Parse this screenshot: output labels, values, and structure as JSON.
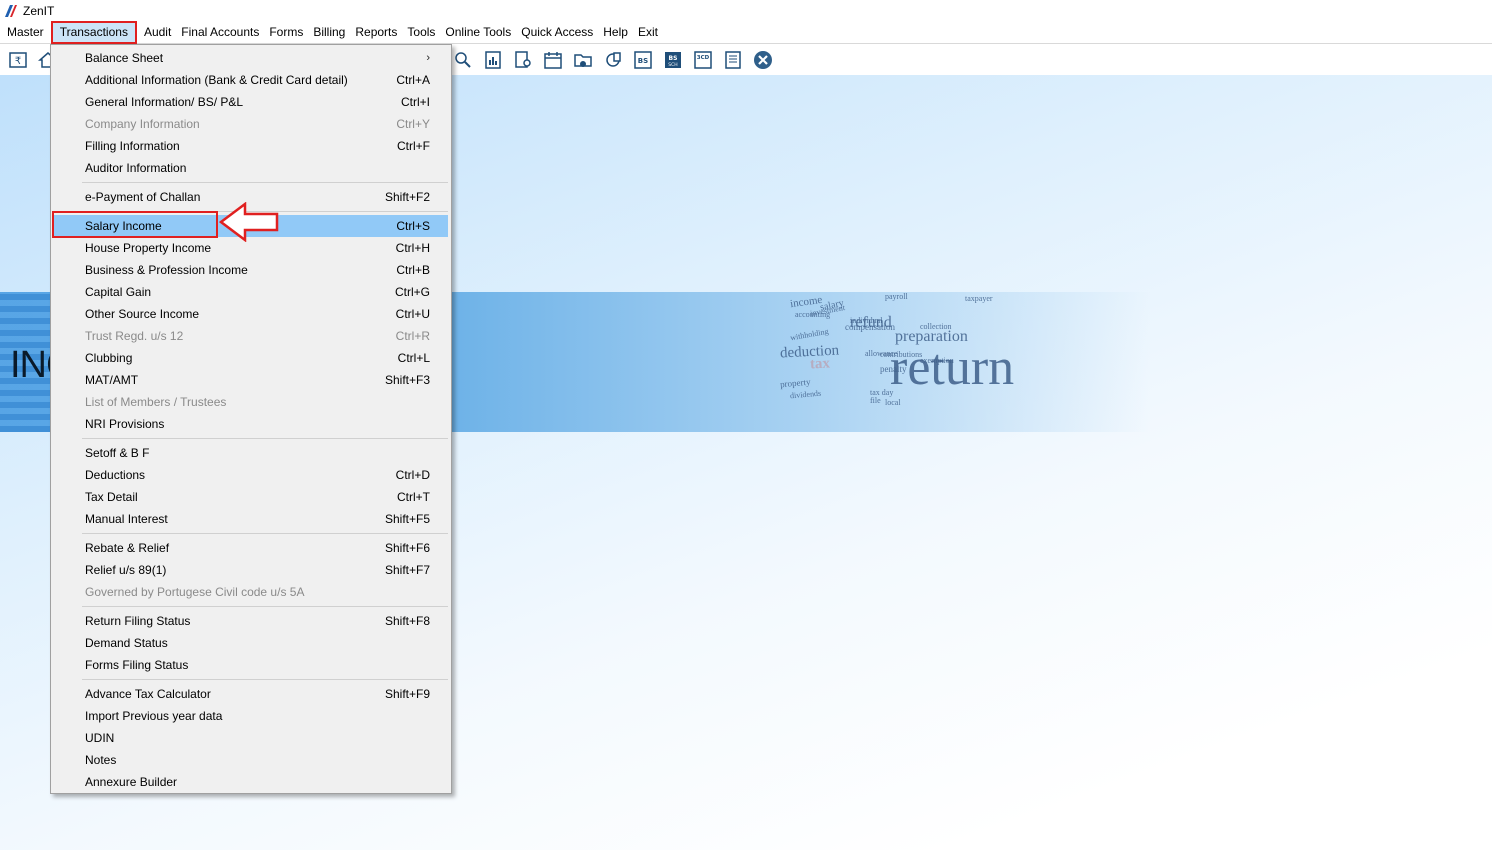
{
  "app": {
    "title": "ZenIT"
  },
  "menubar": [
    {
      "label": "Master",
      "active": false
    },
    {
      "label": "Transactions",
      "active": true
    },
    {
      "label": "Audit",
      "active": false
    },
    {
      "label": "Final Accounts",
      "active": false
    },
    {
      "label": "Forms",
      "active": false
    },
    {
      "label": "Billing",
      "active": false
    },
    {
      "label": "Reports",
      "active": false
    },
    {
      "label": "Tools",
      "active": false
    },
    {
      "label": "Online Tools",
      "active": false
    },
    {
      "label": "Quick Access",
      "active": false
    },
    {
      "label": "Help",
      "active": false
    },
    {
      "label": "Exit",
      "active": false
    }
  ],
  "toolbar": {
    "icons": [
      "rupee-book-icon",
      "home-icon",
      "search-doc-icon",
      "chart-doc-icon",
      "doc-user-icon",
      "calendar-icon",
      "folder-add-icon",
      "refresh-doc-icon",
      "bs-icon",
      "bs-sch-icon",
      "3cd-icon",
      "form-icon",
      "close-circle-icon"
    ],
    "labels": {
      "bs": "BS",
      "bs_sch": "BS",
      "bs_sch_sub": "SCH",
      "threecd": "3CD"
    }
  },
  "banner": {
    "text": "INC",
    "words": [
      "income",
      "refund",
      "preparation",
      "deduction",
      "tax",
      "return",
      "salary",
      "penalty",
      "compensation",
      "property",
      "dividends",
      "payroll",
      "taxpayer",
      "accounting",
      "investment",
      "individual",
      "collection",
      "exemption",
      "withholding",
      "allowance",
      "contributions",
      "tax day",
      "file",
      "local"
    ]
  },
  "dropdown": {
    "items": [
      {
        "label": "Balance Sheet",
        "shortcut": "",
        "submenu": true,
        "disabled": false
      },
      {
        "label": "Additional Information (Bank & Credit Card detail)",
        "shortcut": "Ctrl+A",
        "disabled": false
      },
      {
        "label": "General Information/ BS/ P&L",
        "shortcut": "Ctrl+I",
        "disabled": false
      },
      {
        "label": "Company Information",
        "shortcut": "Ctrl+Y",
        "disabled": true
      },
      {
        "label": "Filling Information",
        "shortcut": "Ctrl+F",
        "disabled": false
      },
      {
        "label": "Auditor Information",
        "shortcut": "",
        "disabled": false
      },
      {
        "separator": true
      },
      {
        "label": "e-Payment of Challan",
        "shortcut": "Shift+F2",
        "disabled": false
      },
      {
        "separator": true
      },
      {
        "label": "Salary Income",
        "shortcut": "Ctrl+S",
        "disabled": false,
        "highlight": true
      },
      {
        "label": "House Property Income",
        "shortcut": "Ctrl+H",
        "disabled": false
      },
      {
        "label": "Business & Profession Income",
        "shortcut": "Ctrl+B",
        "disabled": false
      },
      {
        "label": "Capital Gain",
        "shortcut": "Ctrl+G",
        "disabled": false
      },
      {
        "label": "Other Source Income",
        "shortcut": "Ctrl+U",
        "disabled": false
      },
      {
        "label": "Trust Regd. u/s 12",
        "shortcut": "Ctrl+R",
        "disabled": true
      },
      {
        "label": "Clubbing",
        "shortcut": "Ctrl+L",
        "disabled": false
      },
      {
        "label": "MAT/AMT",
        "shortcut": "Shift+F3",
        "disabled": false
      },
      {
        "label": "List of Members / Trustees",
        "shortcut": "",
        "disabled": true
      },
      {
        "label": "NRI Provisions",
        "shortcut": "",
        "disabled": false
      },
      {
        "separator": true
      },
      {
        "label": "Setoff & B F",
        "shortcut": "",
        "disabled": false
      },
      {
        "label": "Deductions",
        "shortcut": "Ctrl+D",
        "disabled": false
      },
      {
        "label": "Tax Detail",
        "shortcut": "Ctrl+T",
        "disabled": false
      },
      {
        "label": "Manual Interest",
        "shortcut": "Shift+F5",
        "disabled": false
      },
      {
        "separator": true
      },
      {
        "label": "Rebate & Relief",
        "shortcut": "Shift+F6",
        "disabled": false
      },
      {
        "label": "Relief u/s 89(1)",
        "shortcut": "Shift+F7",
        "disabled": false
      },
      {
        "label": "Governed by Portugese Civil code u/s 5A",
        "shortcut": "",
        "disabled": true
      },
      {
        "separator": true
      },
      {
        "label": "Return Filing Status",
        "shortcut": "Shift+F8",
        "disabled": false
      },
      {
        "label": "Demand Status",
        "shortcut": "",
        "disabled": false
      },
      {
        "label": "Forms Filing Status",
        "shortcut": "",
        "disabled": false
      },
      {
        "separator": true
      },
      {
        "label": "Advance Tax Calculator",
        "shortcut": "Shift+F9",
        "disabled": false
      },
      {
        "label": "Import Previous year data",
        "shortcut": "",
        "disabled": false
      },
      {
        "label": "UDIN",
        "shortcut": "",
        "disabled": false
      },
      {
        "label": "Notes",
        "shortcut": "",
        "disabled": false
      },
      {
        "label": "Annexure Builder",
        "shortcut": "",
        "disabled": false
      }
    ]
  },
  "colors": {
    "highlight": "#91c9f7",
    "annotation_red": "#e02020",
    "menu_active": "#cce4f7",
    "toolbar_icon": "#1f4e79"
  }
}
